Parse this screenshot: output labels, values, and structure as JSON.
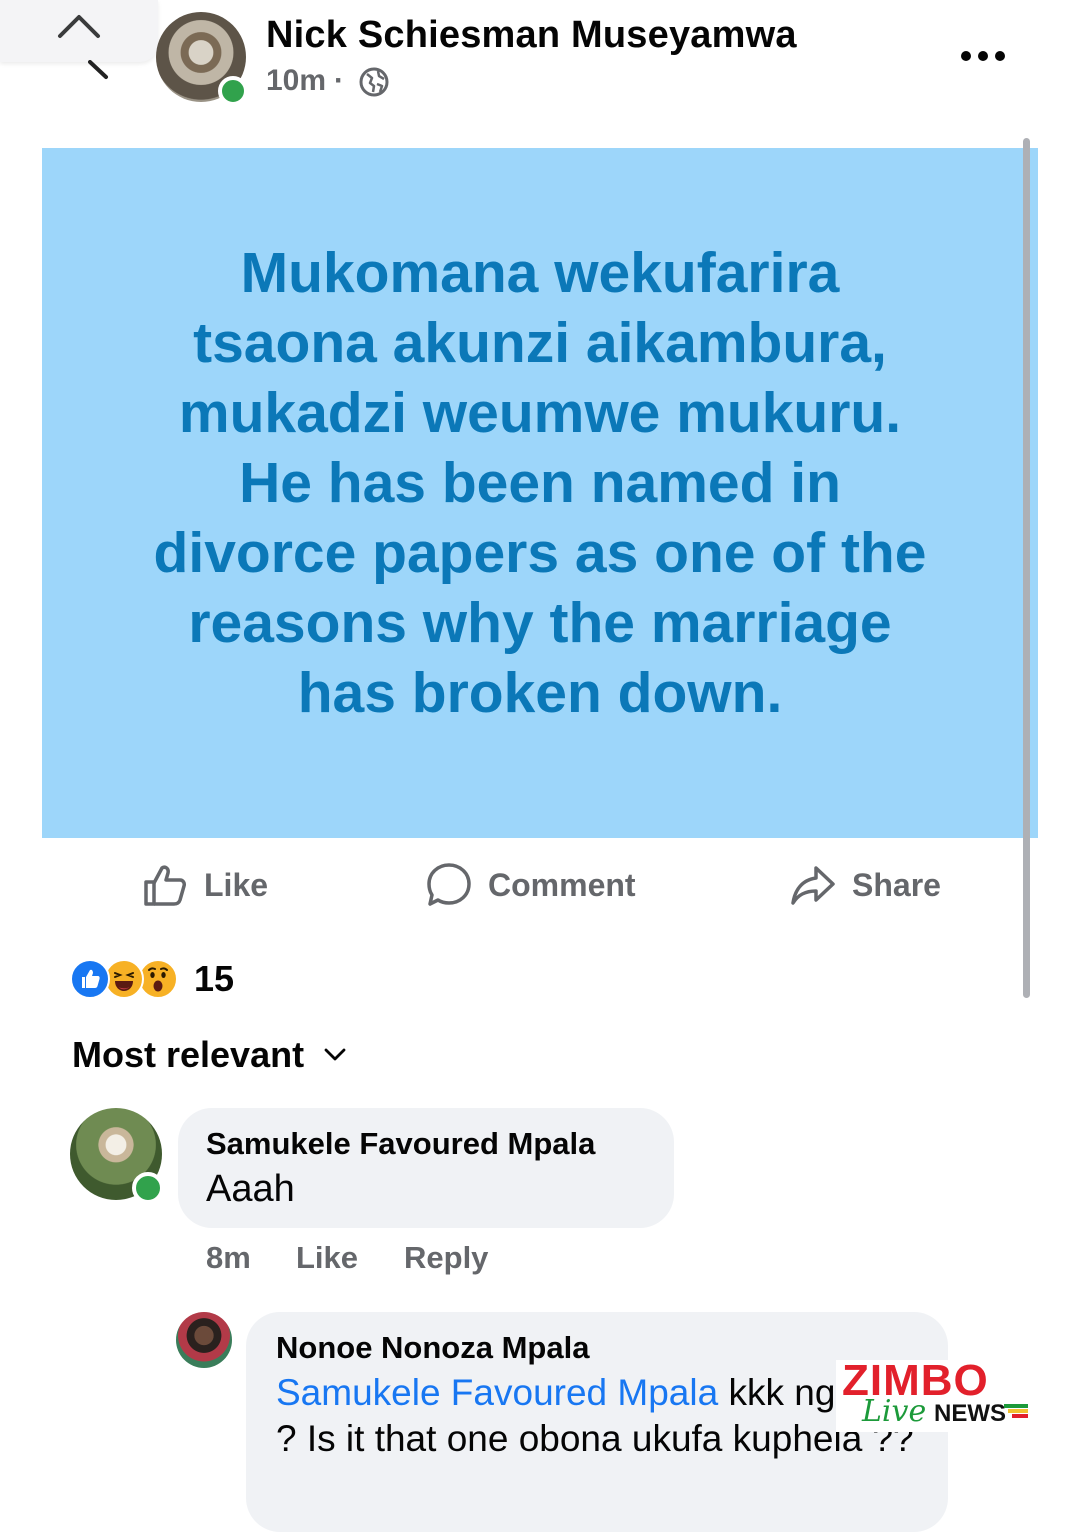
{
  "colors": {
    "post_background": "#9dd6fa",
    "post_text": "#0b78b8",
    "online": "#31a24c",
    "mention": "#1877f2",
    "secondary_text": "#65676b",
    "comment_bubble": "#f0f2f5",
    "logo_red": "#e2202b",
    "logo_green": "#1c9a3a"
  },
  "header": {
    "author_name": "Nick Schiesman Museyamwa",
    "time": "10m",
    "separator": "·",
    "audience_icon": "globe-icon",
    "more_icon": "more-dots-icon"
  },
  "post": {
    "text": "Mukomana wekufarira\ntsaona akunzi aikambura,\nmukadzi weumwe mukuru.\nHe has been named in\ndivorce papers as one of the\nreasons why the  marriage\nhas broken down."
  },
  "actions": {
    "like": "Like",
    "comment": "Comment",
    "share": "Share"
  },
  "reactions": {
    "icons": [
      "like-reaction",
      "haha-reaction",
      "wow-reaction"
    ],
    "count": "15"
  },
  "sort": {
    "label": "Most relevant"
  },
  "comments": [
    {
      "name": "Samukele Favoured Mpala",
      "text": "Aaah",
      "time": "8m",
      "like": "Like",
      "reply": "Reply"
    },
    {
      "name": "Nonoe Nonoza Mpala",
      "mention": "Samukele Favoured Mpala",
      "text": " kkk nguphi ? Is it that one obona ukufa kuphela ??"
    }
  ],
  "watermark": {
    "brand": "ZIMBO",
    "live": "Live",
    "news": "NEWS"
  }
}
